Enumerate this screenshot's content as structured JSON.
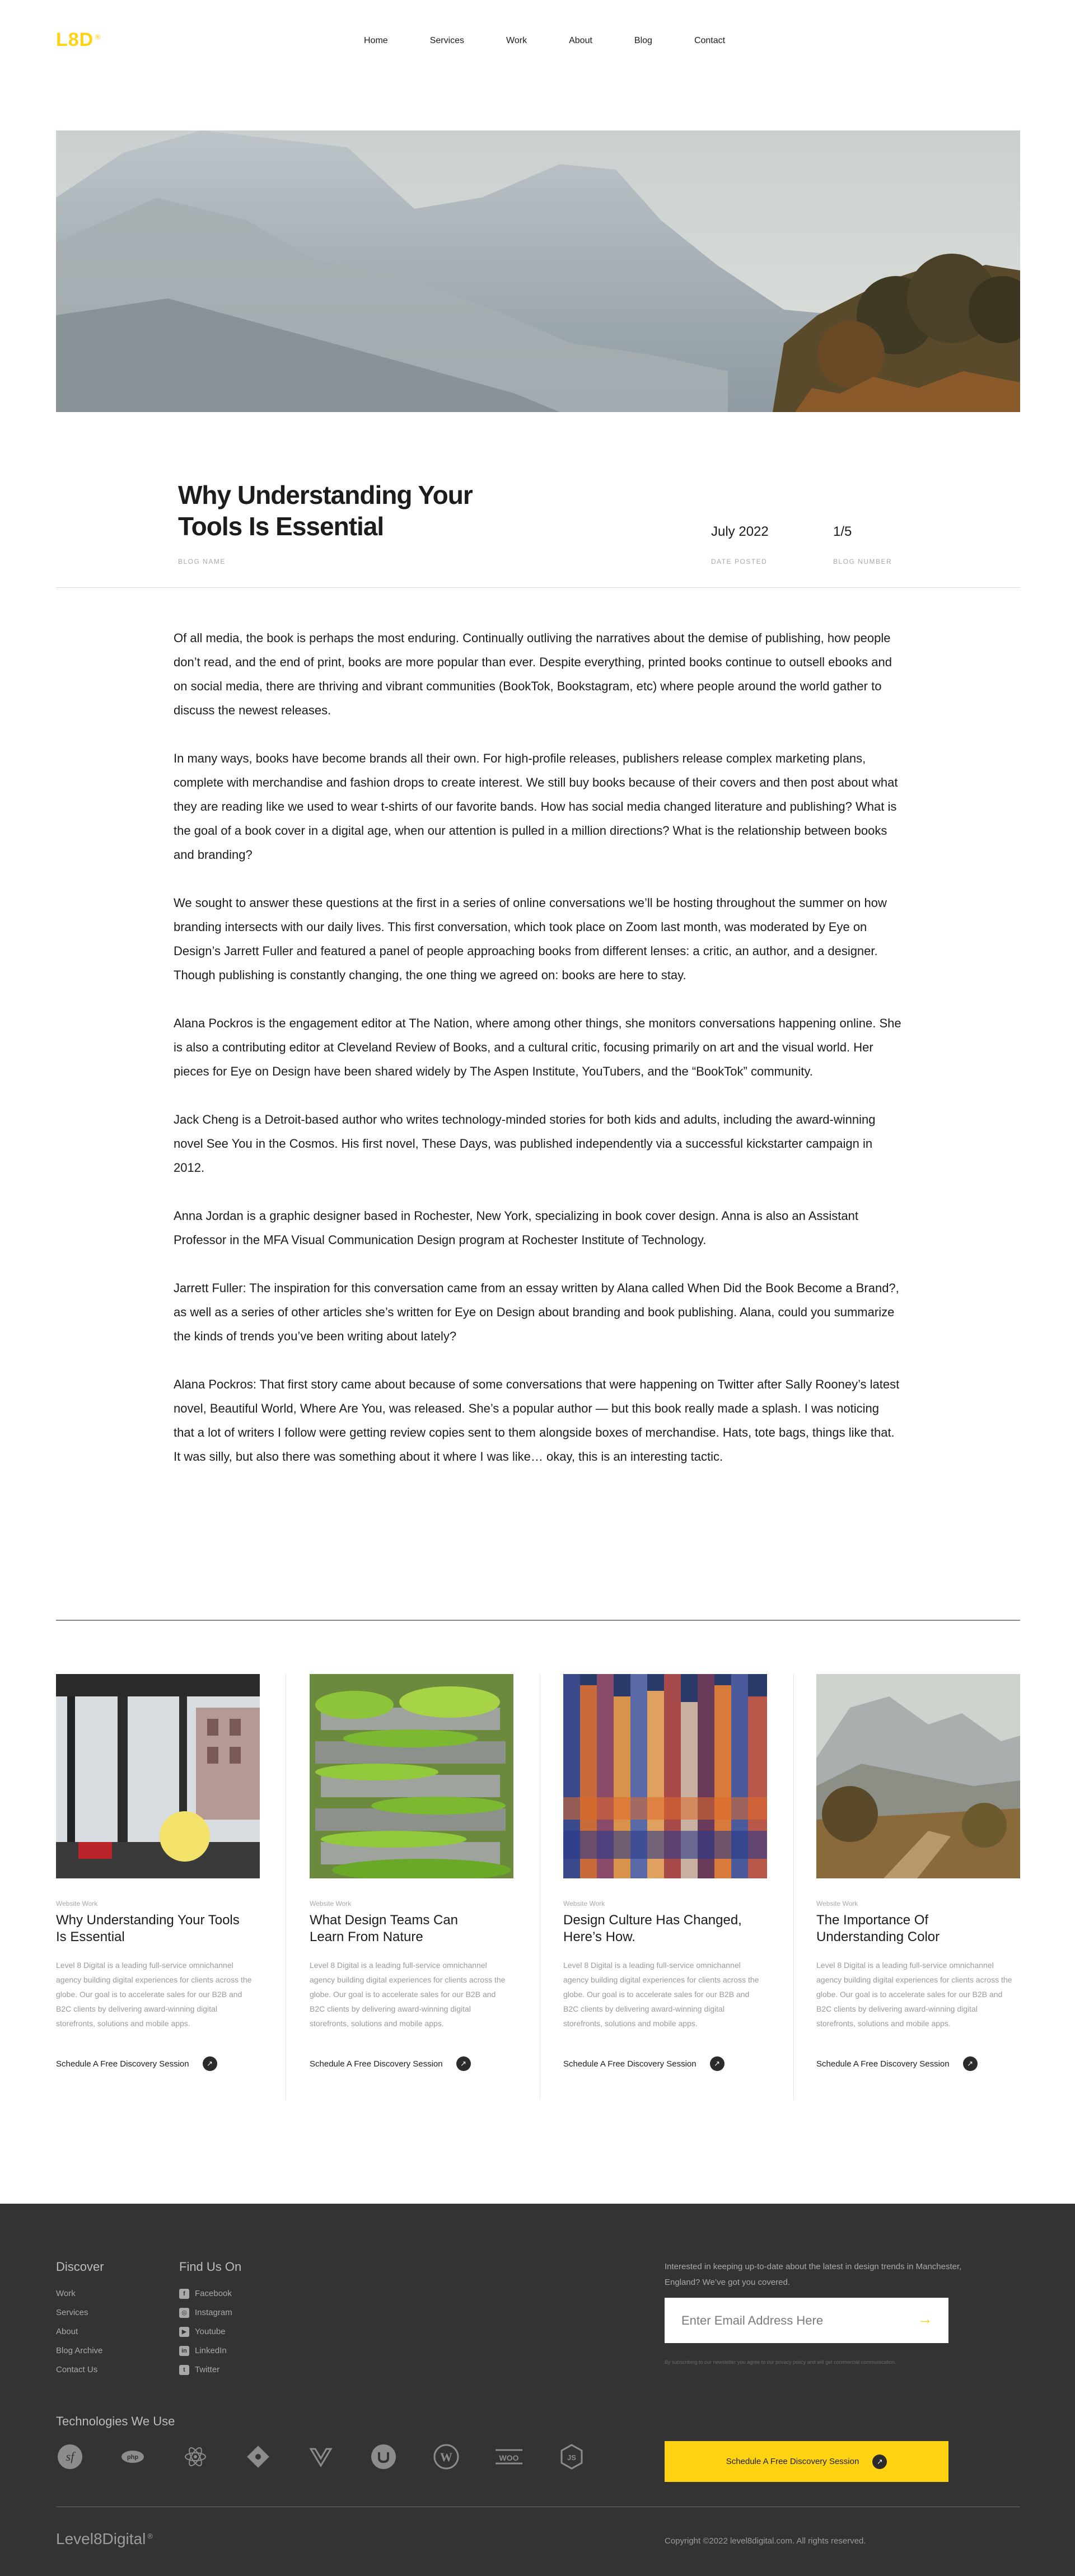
{
  "header": {
    "logo": "L8D",
    "logo_mark": "®",
    "nav": [
      "Home",
      "Services",
      "Work",
      "About",
      "Blog",
      "Contact"
    ]
  },
  "article": {
    "title": "Why Understanding Your Tools Is Essential",
    "blog_name_label": "BLOG NAME",
    "date": "July 2022",
    "date_label": "DATE POSTED",
    "number": "1/5",
    "number_label": "BLOG NUMBER",
    "paragraphs": [
      "Of all media, the book is perhaps the most enduring. Continually outliving the narratives about the demise of publishing, how people don’t read, and the end of print, books are more popular than ever. Despite everything, printed books continue to outsell ebooks and on social media, there are thriving and vibrant communities (BookTok, Bookstagram, etc) where people around the world gather to discuss the newest releases.",
      "In many ways, books have become brands all their own. For high-profile releases, publishers release complex marketing plans, complete with merchandise and fashion drops to create interest. We still buy books because of their covers and then post about what they are reading like we used to wear t-shirts of our favorite bands. How has social media changed literature and publishing? What is the goal of a book cover in a digital age, when our attention is pulled in a million directions? What is the relationship between books and branding?",
      "We sought to answer these questions at the first in a series of online conversations we’ll be hosting throughout the summer on how branding intersects with our daily lives. This first conversation, which took place on Zoom last month, was moderated by Eye on Design’s Jarrett Fuller and featured a panel of people approaching books from different lenses: a critic, an author, and a designer. Though publishing is constantly changing, the one thing we agreed on: books are here to stay.",
      "Alana Pockros is the engagement editor at The Nation, where among other things, she monitors conversations happening online. She is also a contributing editor at Cleveland Review of Books, and a cultural critic, focusing primarily on art and the visual world. Her pieces for Eye on Design have been shared widely by The Aspen Institute, YouTubers, and the “BookTok” community.",
      "Jack Cheng is a Detroit-based author who writes technology-minded stories for both kids and adults, including the award-winning novel See You in the Cosmos. His first novel, These Days, was published independently via a successful kickstarter campaign in 2012.",
      "Anna Jordan is a graphic designer based in Rochester, New York, specializing in book cover design. Anna is also an Assistant Professor in the MFA Visual Communication Design program at Rochester Institute of Technology.",
      "Jarrett Fuller: The inspiration for this conversation came from an essay written by Alana called When Did the Book Become a Brand?, as well as a series of other articles she’s written for Eye on Design about branding and book publishing. Alana, could you summarize the kinds of trends you’ve been writing about lately?",
      "Alana Pockros: That first story came about because of some conversations that were happening on Twitter after Sally Rooney’s latest novel, Beautiful World, Where Are You, was released. She’s a popular author — but this book really made a splash. I was noticing that a lot of writers I follow were getting review copies sent to them alongside boxes of merchandise. Hats, tote bags, things like that. It was silly, but also there was something about it where I was like… okay, this is an interesting tactic."
    ]
  },
  "cards": [
    {
      "category": "Website Work",
      "title": "Why Understanding Your Tools Is Essential",
      "desc": "Level 8 Digital is a leading full-service omnichannel agency building digital experiences for clients across the globe. Our goal is to accelerate sales for our B2B and B2C clients by delivering award-winning digital storefronts, solutions and mobile apps.",
      "cta": "Schedule A Free Discovery Session"
    },
    {
      "category": "Website Work",
      "title": "What Design Teams Can Learn From Nature",
      "desc": "Level 8 Digital is a leading full-service omnichannel agency building digital experiences for clients across the globe. Our goal is to accelerate sales for our B2B and B2C clients by delivering award-winning digital storefronts, solutions and mobile apps.",
      "cta": "Schedule A Free Discovery Session"
    },
    {
      "category": "Website Work",
      "title": "Design Culture Has Changed, Here’s How.",
      "desc": "Level 8 Digital is a leading full-service omnichannel agency building digital experiences for clients across the globe. Our goal is to accelerate sales for our B2B and B2C clients by delivering award-winning digital storefronts, solutions and mobile apps.",
      "cta": "Schedule A Free Discovery Session"
    },
    {
      "category": "Website Work",
      "title": "The Importance Of Understanding Color",
      "desc": "Level 8 Digital is a leading full-service omnichannel agency building digital experiences for clients across the globe. Our goal is to accelerate sales for our B2B and B2C clients by delivering award-winning digital storefronts, solutions and mobile apps.",
      "cta": "Schedule A Free Discovery Session"
    }
  ],
  "footer": {
    "discover_title": "Discover",
    "discover_links": [
      "Work",
      "Services",
      "About",
      "Blog Archive",
      "Contact Us"
    ],
    "find_title": "Find Us On",
    "social": [
      {
        "label": "Facebook",
        "icon": "facebook-icon"
      },
      {
        "label": "Instagram",
        "icon": "instagram-icon"
      },
      {
        "label": "Youtube",
        "icon": "youtube-icon"
      },
      {
        "label": "LinkedIn",
        "icon": "linkedin-icon"
      },
      {
        "label": "Twitter",
        "icon": "twitter-icon"
      }
    ],
    "newsletter_text": "Interested in keeping up-to-date about the latest in design trends in Manchester, England? We’ve got you covered.",
    "email_placeholder": "Enter Email Address Here",
    "fine_print": "By subscribing to our newsletter you agree to our privacy policy and will get commercial communication.",
    "tech_title": "Technologies We Use",
    "tech_icons": [
      "symfony-icon",
      "php-icon",
      "react-icon",
      "craft-icon",
      "vue-icon",
      "umbraco-icon",
      "wordpress-icon",
      "woocommerce-icon",
      "nodejs-icon"
    ],
    "cta": "Schedule A Free Discovery Session",
    "brand": "Level8Digital",
    "brand_mark": "®",
    "copyright": "Copyright ©2022 level8digital.com. All rights reserved."
  },
  "colors": {
    "accent": "#ffd312",
    "footer_bg": "#333333",
    "text": "#1c1c1c"
  }
}
